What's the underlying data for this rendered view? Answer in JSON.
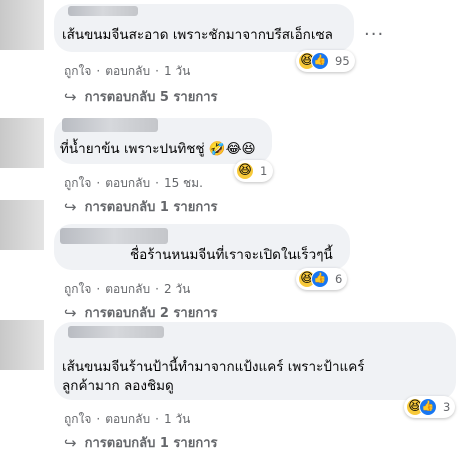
{
  "comments": [
    {
      "text": "เส้นขนมจีนสะอาด เพราะชักมาจากบรีสเอ็กเซล",
      "reaction_count": "95",
      "like": "ถูกใจ",
      "reply": "ตอบกลับ",
      "time": "1 วัน",
      "replies": "การตอบกลับ 5 รายการ"
    },
    {
      "text": "ที่น้ำยาข้น เพราะปนทิชชู่",
      "reaction_count": "1",
      "like": "ถูกใจ",
      "reply": "ตอบกลับ",
      "time": "15 ชม.",
      "replies": "การตอบกลับ 1 รายการ"
    },
    {
      "text": "ชื่อร้านหนมจีนที่เราจะเปิดในเร็วๆนี้",
      "reaction_count": "6",
      "like": "ถูกใจ",
      "reply": "ตอบกลับ",
      "time": "2 วัน",
      "replies": "การตอบกลับ 2 รายการ"
    },
    {
      "text": "เส้นขนมจีนร้านป้านี้ทำมาจากแป้งแคร์ เพราะป้าแคร์ลูกค้ามาก ลองชิมดู",
      "reaction_count": "3",
      "like": "ถูกใจ",
      "reply": "ตอบกลับ",
      "time": "1 วัน",
      "replies": "การตอบกลับ 1 รายการ"
    }
  ],
  "more_icon": "···",
  "dot": "·",
  "reply_arrow": "↪",
  "icons": {
    "reaction_haha": "😆",
    "reaction_like": "👍",
    "emoji_rofl": "🤣",
    "emoji_joy": "😂",
    "emoji_laugh": "😆"
  }
}
